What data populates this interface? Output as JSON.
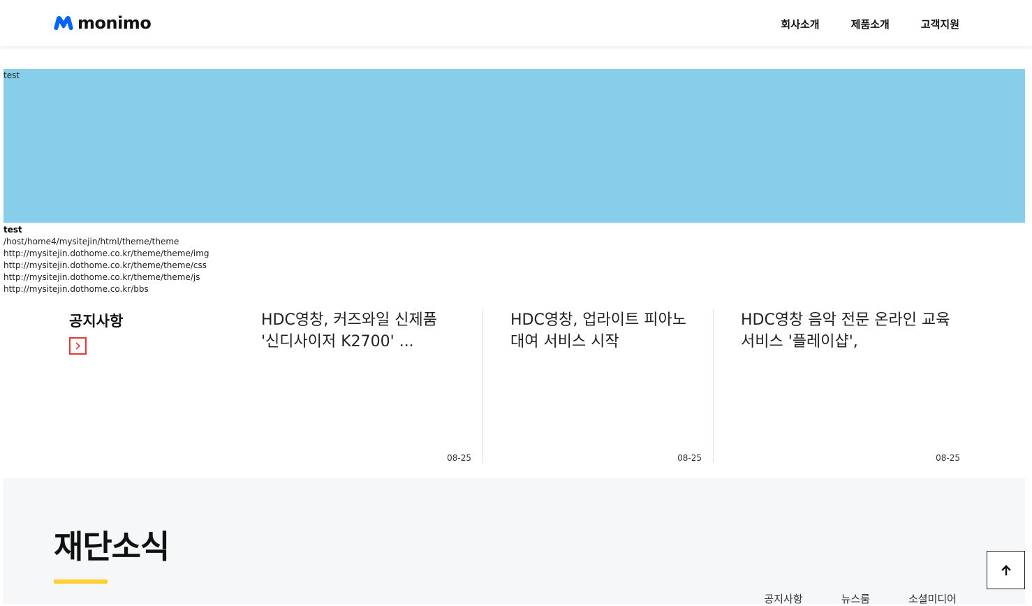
{
  "header": {
    "logo_text": "monimo",
    "brand_color": "#0064ff",
    "nav": [
      {
        "label": "회사소개"
      },
      {
        "label": "제품소개"
      },
      {
        "label": "고객지원"
      }
    ]
  },
  "debug_banner": {
    "label": "test",
    "color": "#87ceea"
  },
  "debug_lines": {
    "title": "test",
    "lines": [
      "/host/home4/mysitejin/html/theme/theme",
      "http://mysitejin.dothome.co.kr/theme/theme/img",
      "http://mysitejin.dothome.co.kr/theme/theme/css",
      "http://mysitejin.dothome.co.kr/theme/theme/js",
      "http://mysitejin.dothome.co.kr/bbs"
    ]
  },
  "notice": {
    "title": "공지사항",
    "more_icon": "chevron-right-icon",
    "accent_color": "#e53935",
    "items": [
      {
        "title": "HDC영창, 커즈와일 신제품 '신디사이저 K2700' ...",
        "date": "08-25"
      },
      {
        "title": "HDC영창, 업라이트 피아노 대여 서비스 시작",
        "date": "08-25"
      },
      {
        "title": "HDC영창 음악 전문 온라인 교육 서비스 '플레이샵',",
        "date": "08-25"
      }
    ]
  },
  "news": {
    "title": "재단소식",
    "accent_color": "#ffcf3a",
    "tabs": [
      {
        "label": "공지사항"
      },
      {
        "label": "뉴스룸"
      },
      {
        "label": "소셜미디어"
      }
    ]
  },
  "top_button": {
    "icon": "arrow-up-icon"
  }
}
